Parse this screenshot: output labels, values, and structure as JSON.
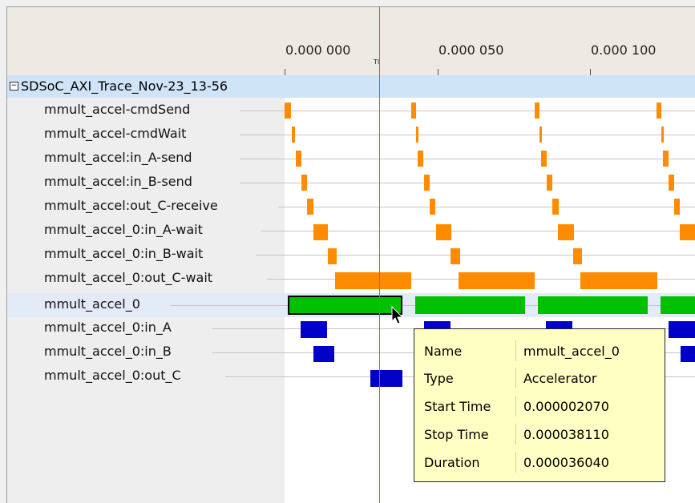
{
  "timeline": {
    "ticks": [
      "0.000 000",
      "0.000 050",
      "0.000 100"
    ],
    "cursor_marker": "TI"
  },
  "group": {
    "toggle": "−",
    "label": "SDSoC_AXI_Trace_Nov-23_13-56"
  },
  "rows": [
    {
      "label": "mmult_accel-cmdSend"
    },
    {
      "label": "mmult_accel-cmdWait"
    },
    {
      "label": "mmult_accel:in_A-send"
    },
    {
      "label": "mmult_accel:in_B-send"
    },
    {
      "label": "mmult_accel:out_C-receive"
    },
    {
      "label": "mmult_accel_0:in_A-wait"
    },
    {
      "label": "mmult_accel_0:in_B-wait"
    },
    {
      "label": "mmult_accel_0:out_C-wait"
    },
    {
      "label": "mmult_accel_0"
    },
    {
      "label": "mmult_accel_0:in_A"
    },
    {
      "label": "mmult_accel_0:in_B"
    },
    {
      "label": "mmult_accel_0:out_C"
    }
  ],
  "tooltip": {
    "name_key": "Name",
    "name_val": "mmult_accel_0",
    "type_key": "Type",
    "type_val": "Accelerator",
    "start_key": "Start Time",
    "start_val": "0.000002070",
    "stop_key": "Stop Time",
    "stop_val": "0.000038110",
    "dur_key": "Duration",
    "dur_val": "0.000036040"
  },
  "colors": {
    "send_wait": "#ff8c00",
    "accelerator": "#00c000",
    "data_transfer": "#0000c8",
    "selection": "#cfe4f7"
  }
}
